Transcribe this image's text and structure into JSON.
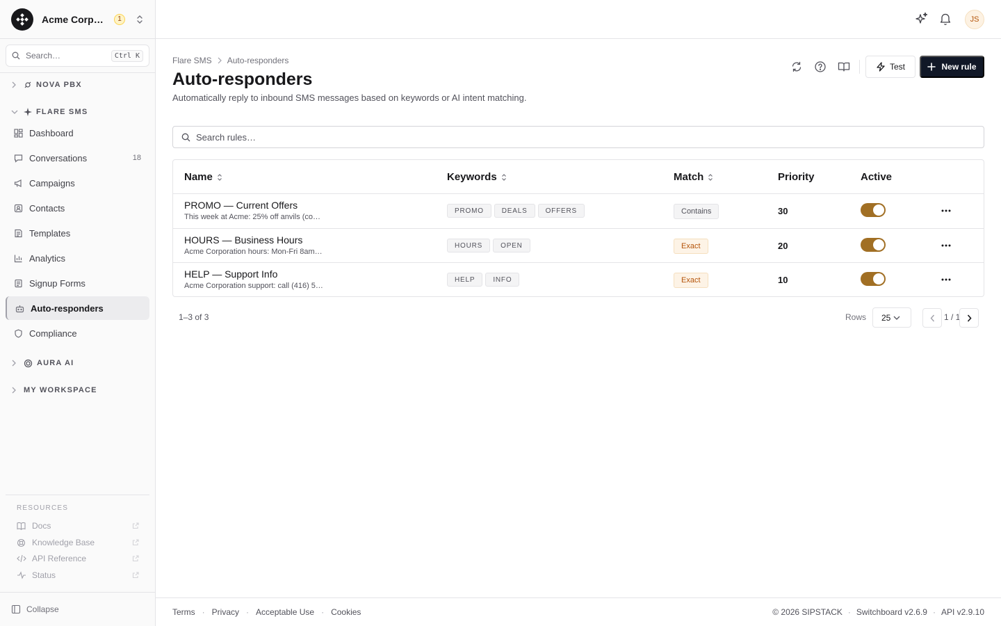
{
  "org": {
    "name": "Acme Corporation",
    "badge": "1"
  },
  "sidebar": {
    "search": {
      "placeholder": "Search…",
      "shortcut": "Ctrl K"
    },
    "groups": {
      "nova": "NOVA PBX",
      "flare": "FLARE SMS",
      "aura": "AURA AI",
      "workspace": "MY WORKSPACE"
    },
    "items": [
      {
        "label": "Dashboard",
        "icon": "dashboard-icon"
      },
      {
        "label": "Conversations",
        "icon": "chat-icon",
        "count": "18"
      },
      {
        "label": "Campaigns",
        "icon": "megaphone-icon"
      },
      {
        "label": "Contacts",
        "icon": "contacts-icon"
      },
      {
        "label": "Templates",
        "icon": "templates-icon"
      },
      {
        "label": "Analytics",
        "icon": "analytics-icon"
      },
      {
        "label": "Signup Forms",
        "icon": "form-icon"
      },
      {
        "label": "Auto-responders",
        "icon": "bot-icon",
        "active": true
      },
      {
        "label": "Compliance",
        "icon": "shield-icon"
      }
    ],
    "resources": {
      "title": "RESOURCES",
      "items": [
        {
          "label": "Docs",
          "icon": "book-icon"
        },
        {
          "label": "Knowledge Base",
          "icon": "lifebuoy-icon"
        },
        {
          "label": "API Reference",
          "icon": "code-icon"
        },
        {
          "label": "Status",
          "icon": "activity-icon"
        }
      ]
    },
    "collapse_label": "Collapse"
  },
  "topbar": {
    "avatar": "JS"
  },
  "header": {
    "breadcrumb": [
      "Flare SMS",
      "Auto-responders"
    ],
    "title": "Auto-responders",
    "subtitle": "Automatically reply to inbound SMS messages based on keywords or AI intent matching.",
    "test_label": "Test",
    "new_label": "New rule"
  },
  "search": {
    "placeholder": "Search rules…"
  },
  "table": {
    "columns": [
      "Name",
      "Keywords",
      "Match",
      "Priority",
      "Active"
    ],
    "rows": [
      {
        "name": "PROMO — Current Offers",
        "desc": "This week at Acme: 25% off anvils (co…",
        "keywords": [
          "PROMO",
          "DEALS",
          "OFFERS"
        ],
        "match": "Contains",
        "priority": "30",
        "active": true
      },
      {
        "name": "HOURS — Business Hours",
        "desc": "Acme Corporation hours: Mon-Fri 8am…",
        "keywords": [
          "HOURS",
          "OPEN"
        ],
        "match": "Exact",
        "priority": "20",
        "active": true
      },
      {
        "name": "HELP — Support Info",
        "desc": "Acme Corporation support: call (416) 5…",
        "keywords": [
          "HELP",
          "INFO"
        ],
        "match": "Exact",
        "priority": "10",
        "active": true
      }
    ],
    "range": "1–3 of 3",
    "rows_label": "Rows",
    "rows_value": "25",
    "page": "1 / 1"
  },
  "footer": {
    "links": [
      "Terms",
      "Privacy",
      "Acceptable Use",
      "Cookies"
    ],
    "copyright": "© 2026 SIPSTACK",
    "version": "Switchboard v2.6.9",
    "api": "API v2.9.10"
  },
  "colors": {
    "primary_button": "#111827",
    "toggle_on": "#a16f24",
    "exact_badge": "#b45309"
  }
}
